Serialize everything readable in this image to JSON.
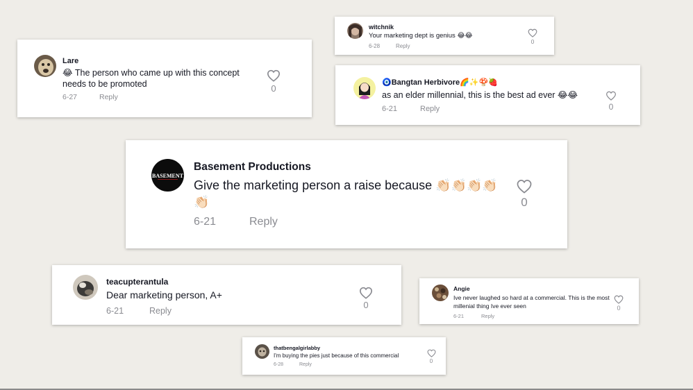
{
  "comments": [
    {
      "user": "witchnik",
      "text": "Your marketing dept is genius 😂😂",
      "date": "6-28",
      "reply": "Reply",
      "likes": "0"
    },
    {
      "user": "Lare",
      "text": "😂 The person who came up with this concept needs to be promoted",
      "date": "6-27",
      "reply": "Reply",
      "likes": "0"
    },
    {
      "user": "🧿Bangtan Herbivore🌈✨🍄🍓",
      "text": "as an elder millennial, this is the best ad ever 😂😂",
      "date": "6-21",
      "reply": "Reply",
      "likes": "0"
    },
    {
      "user": "Basement Productions",
      "text": "Give the marketing person a raise because 👏🏻👏🏻👏🏻👏🏻👏🏻",
      "date": "6-21",
      "reply": "Reply",
      "likes": "0",
      "avatar_text": "BASEMENT"
    },
    {
      "user": "teacupterantula",
      "text": "Dear marketing person, A+",
      "date": "6-21",
      "reply": "Reply",
      "likes": "0"
    },
    {
      "user": "Angie",
      "text": "Ive never laughed so hard at a commercial. This is the most millenial thing Ive ever seen",
      "date": "6-21",
      "reply": "Reply",
      "likes": "0"
    },
    {
      "user": "thatbengalgirlabby",
      "text": "I'm buying the pies just because of this commercial",
      "date": "6-28",
      "reply": "Reply",
      "likes": "0"
    }
  ]
}
